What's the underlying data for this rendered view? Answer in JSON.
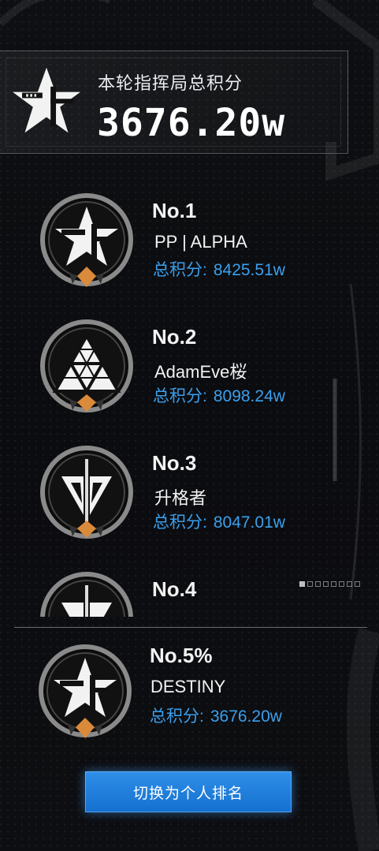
{
  "header": {
    "label": "本轮指挥局总积分",
    "total_score": "3676.20w",
    "emblem_icon": "star-emblem-icon"
  },
  "rankings": [
    {
      "rank": "No.1",
      "name": "PP | ALPHA",
      "score_label": "总积分:",
      "score": "8425.51w",
      "emblem": "star-emblem-icon"
    },
    {
      "rank": "No.2",
      "name": "AdamEve桜",
      "score_label": "总积分:",
      "score": "8098.24w",
      "emblem": "triangle-emblem-icon"
    },
    {
      "rank": "No.3",
      "name": "升格者",
      "score_label": "总积分:",
      "score": "8047.01w",
      "emblem": "sword-emblem-icon"
    },
    {
      "rank": "No.4",
      "name": "",
      "score_label": "",
      "score": "",
      "emblem": "sword-emblem-icon"
    }
  ],
  "self": {
    "rank": "No.5%",
    "name": "DESTINY",
    "score_label": "总积分:",
    "score": "3676.20w",
    "emblem": "star-emblem-icon"
  },
  "actions": {
    "switch_label": "切换为个人排名"
  },
  "pager": {
    "total": 8,
    "active": 0
  },
  "colors": {
    "accent_blue": "#3aa0ee",
    "button_blue": "#1f7fdc",
    "badge_orange": "#d98a3a"
  }
}
